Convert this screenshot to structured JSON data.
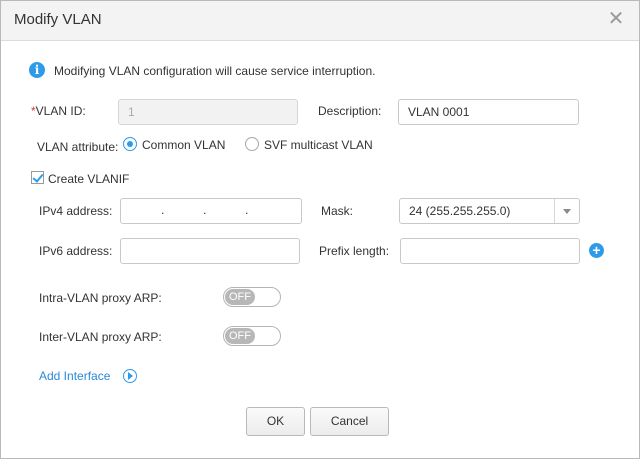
{
  "dialog": {
    "title": "Modify VLAN",
    "close_glyph": "✕"
  },
  "notice": {
    "icon": "info-icon",
    "icon_glyph": "i",
    "text": "Modifying VLAN configuration will cause service interruption."
  },
  "form": {
    "vlan_id": {
      "required_mark": "*",
      "label": "VLAN ID:",
      "value": "1",
      "disabled": true
    },
    "description": {
      "label": "Description:",
      "value": "VLAN 0001"
    },
    "vlan_attribute": {
      "label": "VLAN attribute:",
      "options": [
        {
          "label": "Common VLAN",
          "selected": true
        },
        {
          "label": "SVF multicast VLAN",
          "selected": false
        }
      ]
    },
    "create_vlanif": {
      "label": "Create VLANIF",
      "checked": true
    },
    "ipv4_address": {
      "label": "IPv4 address:",
      "value": "",
      "separator": "."
    },
    "mask": {
      "label": "Mask:",
      "value": "24 (255.255.255.0)"
    },
    "ipv6_address": {
      "label": "IPv6 address:",
      "value": ""
    },
    "prefix_length": {
      "label": "Prefix length:",
      "value": "",
      "add_glyph": "+"
    },
    "intra_vlan_proxy_arp": {
      "label": "Intra-VLAN proxy ARP:",
      "state": "OFF"
    },
    "inter_vlan_proxy_arp": {
      "label": "Inter-VLAN proxy ARP:",
      "state": "OFF"
    },
    "add_interface": {
      "label": "Add Interface"
    }
  },
  "buttons": {
    "ok": "OK",
    "cancel": "Cancel"
  },
  "colors": {
    "accent": "#2e9be9",
    "required": "#e0352b",
    "link": "#2a8ad8",
    "toggle_off": "#b7b7b7"
  }
}
